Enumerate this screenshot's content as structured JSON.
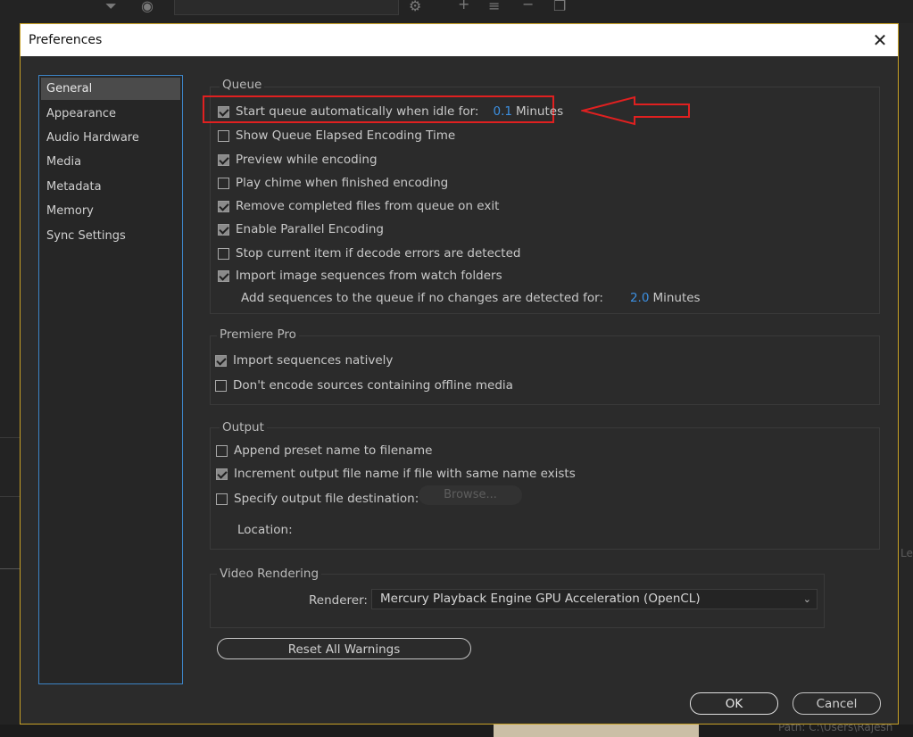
{
  "background": {
    "bottom_path_label": "Path:",
    "bottom_path_value": "C:\\Users\\Rajesh",
    "right_edge_text": "Ler"
  },
  "dialog": {
    "title": "Preferences",
    "close_glyph": "✕"
  },
  "sidebar": {
    "items": [
      {
        "label": "General",
        "selected": true
      },
      {
        "label": "Appearance"
      },
      {
        "label": "Audio Hardware"
      },
      {
        "label": "Media"
      },
      {
        "label": "Metadata"
      },
      {
        "label": "Memory"
      },
      {
        "label": "Sync Settings"
      }
    ]
  },
  "queue": {
    "title": "Queue",
    "start_auto_label": "Start queue automatically when idle for:",
    "start_auto_checked": true,
    "start_auto_value": "0.1",
    "start_auto_unit": "Minutes",
    "show_elapsed_label": "Show Queue Elapsed Encoding Time",
    "show_elapsed_checked": false,
    "preview_label": "Preview while encoding",
    "preview_checked": true,
    "chime_label": "Play chime when finished encoding",
    "chime_checked": false,
    "remove_label": "Remove completed files from queue on exit",
    "remove_checked": true,
    "parallel_label": "Enable Parallel Encoding",
    "parallel_checked": true,
    "stop_label": "Stop current item if decode errors are detected",
    "stop_checked": false,
    "import_seq_label": "Import image sequences from watch folders",
    "import_seq_checked": true,
    "add_seq_label": "Add sequences to the queue if no changes are detected for:",
    "add_seq_value": "2.0",
    "add_seq_unit": "Minutes"
  },
  "premiere": {
    "title": "Premiere Pro",
    "import_native_label": "Import sequences natively",
    "import_native_checked": true,
    "dont_encode_label": "Don't encode sources containing offline media",
    "dont_encode_checked": false
  },
  "output": {
    "title": "Output",
    "append_label": "Append preset name to filename",
    "append_checked": false,
    "increment_label": "Increment output file name if file with same name exists",
    "increment_checked": true,
    "specify_label": "Specify output file destination:",
    "specify_checked": false,
    "browse_label": "Browse...",
    "location_label": "Location:"
  },
  "video_rendering": {
    "title": "Video Rendering",
    "renderer_label": "Renderer:",
    "renderer_value": "Mercury Playback Engine GPU Acceleration (OpenCL)"
  },
  "buttons": {
    "reset_warnings": "Reset All Warnings",
    "ok": "OK",
    "cancel": "Cancel"
  },
  "colors": {
    "accent_blue": "#3c8fe0",
    "annotation_red": "#e02020",
    "dialog_border": "#c9a227"
  }
}
